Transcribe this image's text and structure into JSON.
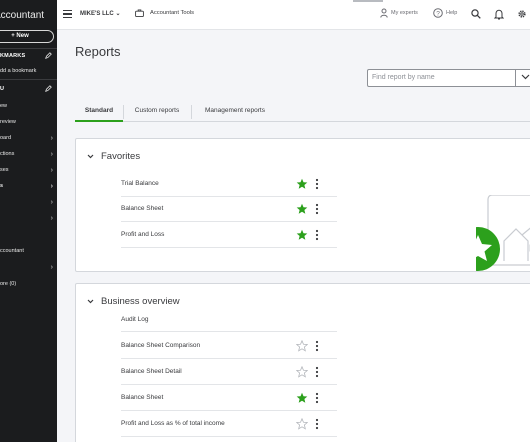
{
  "colors": {
    "sidebar_bg": "#1b1c1e",
    "accent_green": "#2ca01c",
    "text": "#393a3d"
  },
  "sidebar": {
    "brand": "Accountant",
    "new_label": "+ New",
    "bookmarks_header": "KMARKS",
    "add_bookmark": "dd a bookmark",
    "menu_header": "U",
    "items": [
      {
        "label": "ew",
        "chevron": false
      },
      {
        "label": "review",
        "chevron": false
      },
      {
        "label": "oard",
        "chevron": true
      },
      {
        "label": "ctions",
        "chevron": true
      },
      {
        "label": "ses",
        "chevron": true
      },
      {
        "label": "s",
        "chevron": true
      },
      {
        "label": "",
        "chevron": true
      },
      {
        "label": "",
        "chevron": true
      },
      {
        "label": "",
        "chevron": false
      },
      {
        "label": "ccountant",
        "chevron": false
      },
      {
        "label": "",
        "chevron": true
      },
      {
        "label": "ore (0)",
        "chevron": false
      }
    ]
  },
  "topbar": {
    "company": "MIKE'S LLC",
    "company_chevron": "⌄",
    "tools_label": "Accountant Tools",
    "my_experts": "My experts",
    "help": "Help"
  },
  "page": {
    "title": "Reports",
    "search_placeholder": "Find report by name",
    "tabs": [
      "Standard",
      "Custom reports",
      "Management reports"
    ],
    "active_tab": 0
  },
  "favorites": {
    "title": "Favorites",
    "rows": [
      {
        "label": "Trial Balance",
        "favorited": true
      },
      {
        "label": "Balance Sheet",
        "favorited": true
      },
      {
        "label": "Profit and Loss",
        "favorited": true
      }
    ]
  },
  "business_overview": {
    "title": "Business overview",
    "rows": [
      {
        "label": "Audit Log",
        "favorited": null
      },
      {
        "label": "Balance Sheet Comparison",
        "favorited": false
      },
      {
        "label": "Balance Sheet Detail",
        "favorited": false
      },
      {
        "label": "Balance Sheet",
        "favorited": true
      },
      {
        "label": "Profit and Loss as % of total income",
        "favorited": false
      }
    ]
  }
}
